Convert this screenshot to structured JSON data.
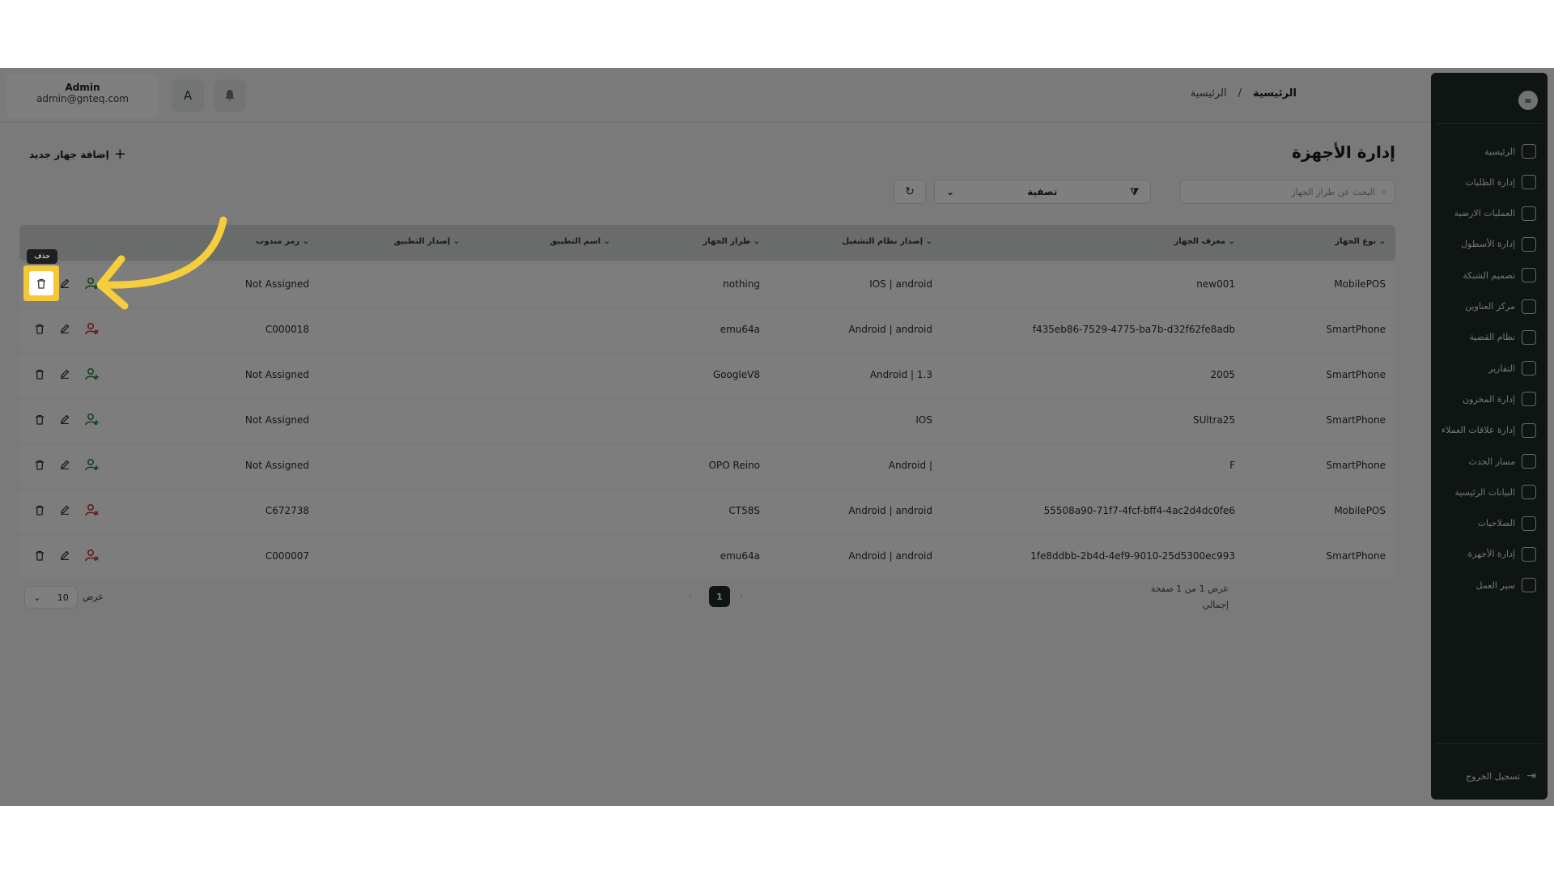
{
  "user": {
    "name": "Admin",
    "email": "admin@gnteq.com"
  },
  "topbar": {
    "translate_glyph": "A"
  },
  "breadcrumb": {
    "current": "الرئيسية",
    "separator": "/",
    "home": "الرئيسية"
  },
  "sidebar": {
    "logo": "∞",
    "items": [
      {
        "label": "الرئيسية",
        "icon": "dashboard-icon"
      },
      {
        "label": "إدارة الطلبات",
        "icon": "orders-icon"
      },
      {
        "label": "العمليات الارضية",
        "icon": "ground-ops-icon"
      },
      {
        "label": "إدارة الأسطول",
        "icon": "truck-icon"
      },
      {
        "label": "تصميم الشبكة",
        "icon": "network-icon"
      },
      {
        "label": "مركز العناوين",
        "icon": "location-icon"
      },
      {
        "label": "نظام القضية",
        "icon": "case-icon"
      },
      {
        "label": "التقارير",
        "icon": "reports-icon"
      },
      {
        "label": "إدارة المخزون",
        "icon": "inventory-icon"
      },
      {
        "label": "إدارة علاقات العملاء",
        "icon": "crm-icon"
      },
      {
        "label": "مسار الحدث",
        "icon": "route-icon"
      },
      {
        "label": "البيانات الرئيسية",
        "icon": "database-icon"
      },
      {
        "label": "الصلاحيات",
        "icon": "users-icon"
      },
      {
        "label": "إدارة الأجهزة",
        "icon": "device-icon"
      },
      {
        "label": "سير العمل",
        "icon": "workflow-icon"
      }
    ],
    "logout": "تسجيل الخروج"
  },
  "page": {
    "title": "إدارة الأجهزة",
    "add_button": "إضافة جهاز جديد",
    "search_placeholder": "البحث عن طراز الجهاز",
    "filter_label": "تصفية"
  },
  "table": {
    "headers": {
      "device_type": "نوع الجهاز",
      "device_id": "معرف الجهاز",
      "os_version": "إصدار نظام التشغيل",
      "device_model": "طراز الجهاز",
      "app_name": "اسم التطبيق",
      "app_version": "إصدار التطبيق",
      "rep_code": "رمز مندوب"
    },
    "rows": [
      {
        "device_type": "MobilePOS",
        "device_id": "new001",
        "os_version": "IOS | android",
        "device_model": "nothing",
        "app_name": "",
        "app_version": "",
        "rep_code": "Not Assigned",
        "assigned": false
      },
      {
        "device_type": "SmartPhone",
        "device_id": "f435eb86-7529-4775-ba7b-d32f62fe8adb",
        "os_version": "Android | android",
        "device_model": "emu64a",
        "app_name": "",
        "app_version": "",
        "rep_code": "C000018",
        "assigned": true
      },
      {
        "device_type": "SmartPhone",
        "device_id": "2005",
        "os_version": "Android | 1.3",
        "device_model": "GoogleV8",
        "app_name": "",
        "app_version": "",
        "rep_code": "Not Assigned",
        "assigned": false
      },
      {
        "device_type": "SmartPhone",
        "device_id": "SUltra25",
        "os_version": "IOS",
        "device_model": "",
        "app_name": "",
        "app_version": "",
        "rep_code": "Not Assigned",
        "assigned": false
      },
      {
        "device_type": "SmartPhone",
        "device_id": "F",
        "os_version": "Android |",
        "device_model": "OPO Reino",
        "app_name": "",
        "app_version": "",
        "rep_code": "Not Assigned",
        "assigned": false
      },
      {
        "device_type": "MobilePOS",
        "device_id": "55508a90-71f7-4fcf-bff4-4ac2d4dc0fe6",
        "os_version": "Android | android",
        "device_model": "CT58S",
        "app_name": "",
        "app_version": "",
        "rep_code": "C672738",
        "assigned": true
      },
      {
        "device_type": "SmartPhone",
        "device_id": "1fe8ddbb-2b4d-4ef9-9010-25d5300ec993",
        "os_version": "Android | android",
        "device_model": "emu64a",
        "app_name": "",
        "app_version": "",
        "rep_code": "C000007",
        "assigned": true
      }
    ],
    "tooltip_delete": "حذف"
  },
  "pagination": {
    "page_size": "10",
    "show_label": "عرض",
    "current_page": "1",
    "info_line1": "عرض 1 من 1 صفحة",
    "info_line2": "إجمالي"
  },
  "colors": {
    "sidebar_bg": "#1e2a27",
    "highlight": "#f4c73a",
    "assign": "#1f8a3a",
    "unassign": "#c9302c"
  }
}
